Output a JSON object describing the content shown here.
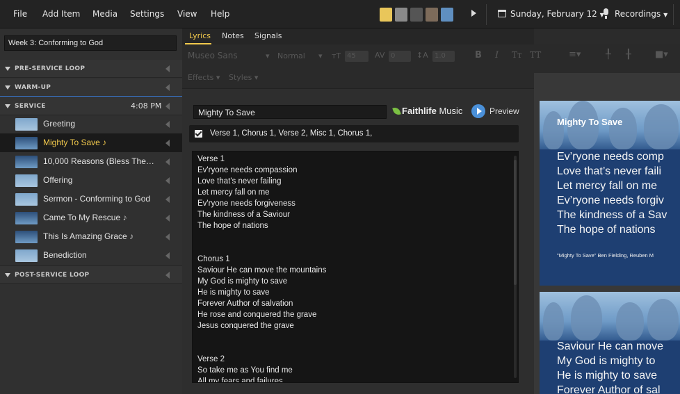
{
  "menu": [
    "File",
    "Add Item",
    "Media",
    "Settings",
    "View",
    "Help"
  ],
  "header": {
    "date": "Sunday, February 12",
    "recordings": "Recordings"
  },
  "plan_title": "Week 3: Conforming to God",
  "sections": {
    "pre_service": "PRE-SERVICE LOOP",
    "warm_up": "WARM-UP",
    "service": "SERVICE",
    "service_time": "4:08 PM",
    "post_service": "POST-SERVICE LOOP"
  },
  "items": [
    {
      "title": "Greeting",
      "thumb": "blue",
      "note": ""
    },
    {
      "title": "Mighty To Save",
      "thumb": "song",
      "note": "♪"
    },
    {
      "title": "10,000 Reasons (Bless The…",
      "thumb": "song",
      "note": ""
    },
    {
      "title": "Offering",
      "thumb": "blue",
      "note": ""
    },
    {
      "title": "Sermon - Conforming to God",
      "thumb": "blue",
      "note": ""
    },
    {
      "title": "Came To My Rescue",
      "thumb": "song",
      "note": "♪"
    },
    {
      "title": "This Is Amazing Grace",
      "thumb": "song",
      "note": "♪"
    },
    {
      "title": "Benediction",
      "thumb": "blue",
      "note": ""
    }
  ],
  "tabs": [
    "Lyrics",
    "Notes",
    "Signals"
  ],
  "toolbar": {
    "font": "Museo Sans",
    "weight": "Normal",
    "size": "45",
    "tracking": "0",
    "leading": "1.0",
    "effects": "Effects",
    "styles": "Styles"
  },
  "song": {
    "title": "Mighty To Save",
    "provider_bold": "Faithlife",
    "provider_light": " Music",
    "preview": "Preview",
    "arrangement": "Verse 1, Chorus 1, Verse 2, Misc 1, Chorus 1,",
    "lyrics": [
      "Verse 1",
      "Ev'ryone needs compassion",
      "Love that's never failing",
      "Let mercy fall on me",
      "Ev'ryone needs forgiveness",
      "The kindness of a Saviour",
      "The hope of nations",
      "",
      "",
      "Chorus 1",
      "Saviour He can move the mountains",
      "My God is mighty to save",
      "He is mighty to save",
      "Forever Author of salvation",
      "He rose and conquered the grave",
      "Jesus conquered the grave",
      "",
      "",
      "Verse 2",
      "So take me as You find me",
      "All my fears and failures"
    ]
  },
  "slides": [
    {
      "title": "Mighty To Save",
      "lines": [
        "Ev’ryone needs comp",
        "Love that’s never faili",
        "Let mercy fall on me",
        "Ev’ryone needs forgiv",
        "The kindness of a Sav",
        "The hope of nations"
      ],
      "credit": "\"Mighty To Save\" Ben Fielding, Reuben M"
    },
    {
      "title": "",
      "lines": [
        "Saviour He can move",
        "My God is mighty to",
        "He is mighty to save",
        "Forever Author of sal"
      ],
      "credit": ""
    }
  ]
}
